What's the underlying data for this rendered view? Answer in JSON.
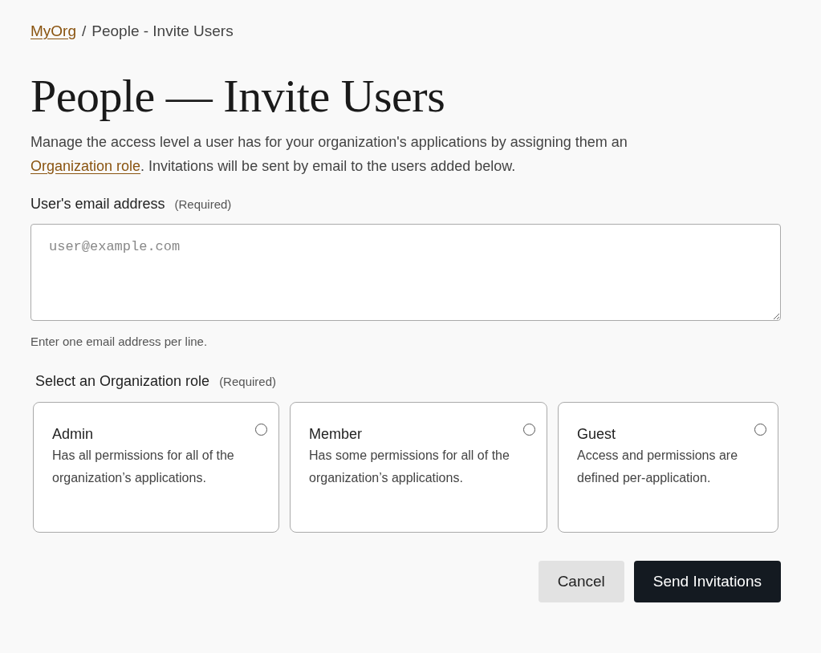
{
  "breadcrumb": {
    "link": "MyOrg",
    "separator": "/",
    "current": "People - Invite Users"
  },
  "title": "People — Invite Users",
  "intro": {
    "before": "Manage the access level a user has for your organization's applications by assigning them an",
    "link": "Organization role",
    "after": ". Invitations will be sent by email to the users added below."
  },
  "email": {
    "label": "User's email address",
    "required": "(Required)",
    "placeholder": "user@example.com",
    "hint": "Enter one email address per line."
  },
  "roles": {
    "label": "Select an Organization role",
    "required": "(Required)",
    "options": [
      {
        "name": "Admin",
        "description": "Has all permissions for all of the organization’s applications.",
        "selected": false
      },
      {
        "name": "Member",
        "description": "Has some permissions for all of the organization’s applications.",
        "selected": false
      },
      {
        "name": "Guest",
        "description": "Access and permissions are defined per-application.",
        "selected": false
      }
    ]
  },
  "buttons": [
    {
      "label": "Cancel",
      "kind": "secondary"
    },
    {
      "label": "Send Invitations",
      "kind": "primary"
    }
  ]
}
